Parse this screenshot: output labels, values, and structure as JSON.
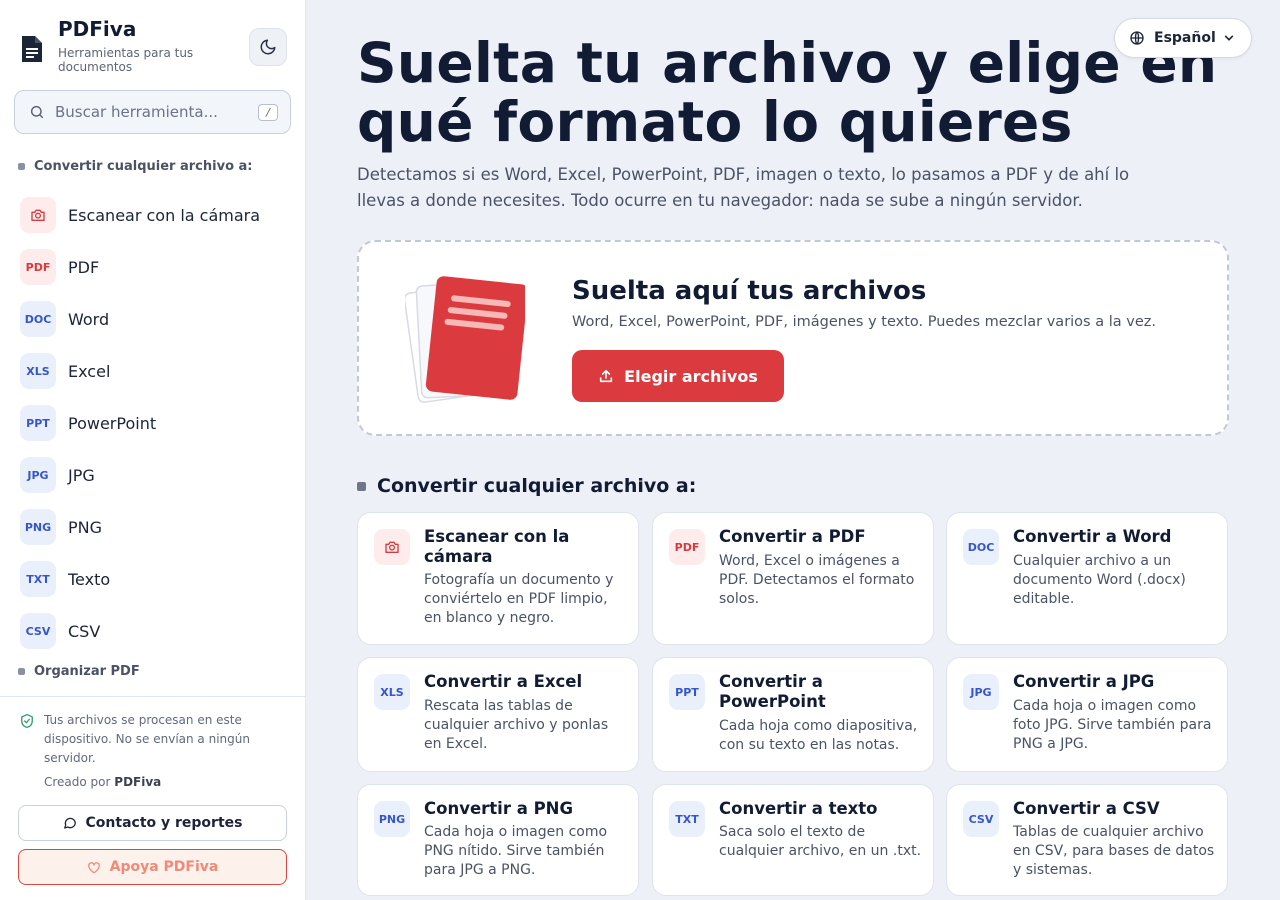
{
  "brand": {
    "name": "PDFiva",
    "tagline": "Herramientas para tus documentos"
  },
  "search": {
    "placeholder": "Buscar herramienta...",
    "shortcut": "/"
  },
  "sidebar": {
    "section_convert": "Convertir cualquier archivo a:",
    "items": [
      {
        "badge": "",
        "label": "Escanear con la cámara",
        "icon": "camera-icon"
      },
      {
        "badge": "PDF",
        "label": "PDF"
      },
      {
        "badge": "DOC",
        "label": "Word"
      },
      {
        "badge": "XLS",
        "label": "Excel"
      },
      {
        "badge": "PPT",
        "label": "PowerPoint"
      },
      {
        "badge": "JPG",
        "label": "JPG"
      },
      {
        "badge": "PNG",
        "label": "PNG"
      },
      {
        "badge": "TXT",
        "label": "Texto"
      },
      {
        "badge": "CSV",
        "label": "CSV"
      }
    ],
    "section_organize": "Organizar PDF",
    "privacy_note": "Tus archivos se procesan en este dispositivo. No se envían a ningún servidor.",
    "created_prefix": "Creado por",
    "created_by": "PDFiva",
    "contact_label": "Contacto y reportes",
    "support_label": "Apoya PDFiva"
  },
  "language": {
    "selected": "Español"
  },
  "hero": {
    "title": "Suelta tu archivo y elige en qué formato lo quieres",
    "subtitle": "Detectamos si es Word, Excel, PowerPoint, PDF, imagen o texto, lo pasamos a PDF y de ahí lo llevas a donde necesites. Todo ocurre en tu navegador: nada se sube a ningún servidor."
  },
  "dropzone": {
    "title": "Suelta aquí tus archivos",
    "subtitle": "Word, Excel, PowerPoint, PDF, imágenes y texto. Puedes mezclar varios a la vez.",
    "button_label": "Elegir archivos"
  },
  "main_section": {
    "title": "Convertir cualquier archivo a:"
  },
  "cards": [
    {
      "badge": "",
      "icon": "camera-icon",
      "title": "Escanear con la cámara",
      "desc": "Fotografía un documento y conviértelo en PDF limpio, en blanco y negro."
    },
    {
      "badge": "PDF",
      "title": "Convertir a PDF",
      "desc": "Word, Excel o imágenes a PDF. Detectamos el formato solos."
    },
    {
      "badge": "DOC",
      "title": "Convertir a Word",
      "desc": "Cualquier archivo a un documento Word (.docx) editable."
    },
    {
      "badge": "XLS",
      "title": "Convertir a Excel",
      "desc": "Rescata las tablas de cualquier archivo y ponlas en Excel."
    },
    {
      "badge": "PPT",
      "title": "Convertir a PowerPoint",
      "desc": "Cada hoja como diapositiva, con su texto en las notas."
    },
    {
      "badge": "JPG",
      "title": "Convertir a JPG",
      "desc": "Cada hoja o imagen como foto JPG. Sirve también para PNG a JPG."
    },
    {
      "badge": "PNG",
      "title": "Convertir a PNG",
      "desc": "Cada hoja o imagen como PNG nítido. Sirve también para JPG a PNG."
    },
    {
      "badge": "TXT",
      "title": "Convertir a texto",
      "desc": "Saca solo el texto de cualquier archivo, en un .txt."
    },
    {
      "badge": "CSV",
      "title": "Convertir a CSV",
      "desc": "Tablas de cualquier archivo en CSV, para bases de datos y sistemas."
    }
  ],
  "colors": {
    "accent": "#db3b3f",
    "text": "#111b33",
    "background": "#edf0f6",
    "badge_blue": "#3556c8"
  }
}
